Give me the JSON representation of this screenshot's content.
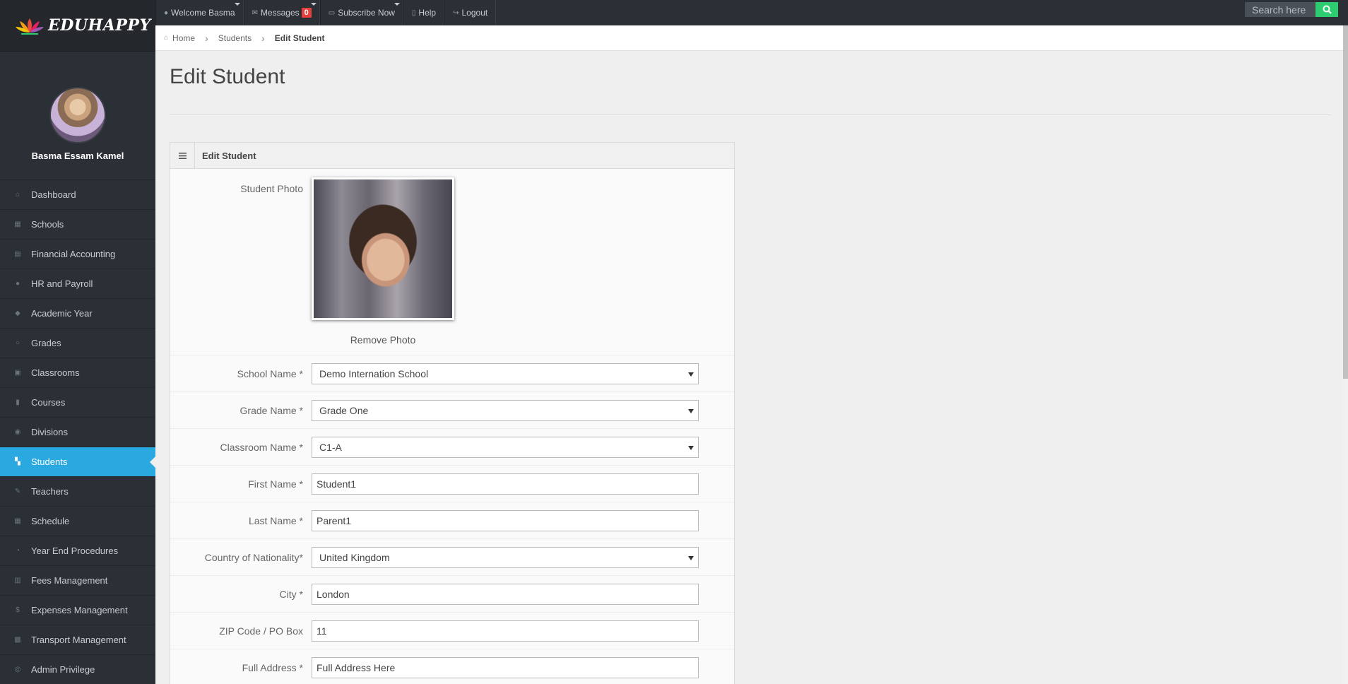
{
  "app": {
    "logo_text": "EDUHAPPY"
  },
  "profile": {
    "name": "Basma Essam Kamel"
  },
  "sidebar": {
    "items": [
      {
        "label": "Dashboard",
        "icon": "home-icon",
        "glyph": "⌂",
        "active": false
      },
      {
        "label": "Schools",
        "icon": "building-icon",
        "glyph": "▦",
        "active": false
      },
      {
        "label": "Financial Accounting",
        "icon": "accounting-icon",
        "glyph": "▤",
        "active": false
      },
      {
        "label": "HR and Payroll",
        "icon": "user-icon",
        "glyph": "●",
        "active": false
      },
      {
        "label": "Academic Year",
        "icon": "graduation-cap-icon",
        "glyph": "◆",
        "active": false
      },
      {
        "label": "Grades",
        "icon": "lightbulb-icon",
        "glyph": "○",
        "active": false
      },
      {
        "label": "Classrooms",
        "icon": "classroom-icon",
        "glyph": "▣",
        "active": false
      },
      {
        "label": "Courses",
        "icon": "book-icon",
        "glyph": "▮",
        "active": false
      },
      {
        "label": "Divisions",
        "icon": "globe-icon",
        "glyph": "◉",
        "active": false
      },
      {
        "label": "Students",
        "icon": "students-icon",
        "glyph": "▚",
        "active": true
      },
      {
        "label": "Teachers",
        "icon": "teacher-icon",
        "glyph": "✎",
        "active": false
      },
      {
        "label": "Schedule",
        "icon": "calendar-icon",
        "glyph": "▦",
        "active": false
      },
      {
        "label": "Year End Procedures",
        "icon": "clock-icon",
        "glyph": "◔",
        "active": false
      },
      {
        "label": "Fees Management",
        "icon": "fees-icon",
        "glyph": "▥",
        "active": false
      },
      {
        "label": "Expenses Management",
        "icon": "dollar-icon",
        "glyph": "$",
        "active": false
      },
      {
        "label": "Transport Management",
        "icon": "bus-icon",
        "glyph": "▩",
        "active": false
      },
      {
        "label": "Admin Privilege",
        "icon": "shield-icon",
        "glyph": "◎",
        "active": false
      }
    ]
  },
  "topbar": {
    "welcome": "Welcome Basma",
    "messages": "Messages",
    "messages_count": "0",
    "subscribe": "Subscribe Now",
    "help": "Help",
    "logout": "Logout",
    "search_placeholder": "Search here"
  },
  "breadcrumb": {
    "home": "Home",
    "section": "Students",
    "current": "Edit Student"
  },
  "page": {
    "title": "Edit Student"
  },
  "panel": {
    "title": "Edit Student",
    "photo_label": "Student Photo",
    "remove_photo": "Remove Photo",
    "fields": {
      "school": {
        "label": "School Name *",
        "value": "Demo Internation School"
      },
      "grade": {
        "label": "Grade Name *",
        "value": "Grade One"
      },
      "classroom": {
        "label": "Classroom Name *",
        "value": "C1-A"
      },
      "first_name": {
        "label": "First Name *",
        "value": "Student1"
      },
      "last_name": {
        "label": "Last Name *",
        "value": "Parent1"
      },
      "country": {
        "label": "Country of Nationality*",
        "value": "United Kingdom"
      },
      "city": {
        "label": "City *",
        "value": "London"
      },
      "zip": {
        "label": "ZIP Code / PO Box",
        "value": "11"
      },
      "address": {
        "label": "Full Address *",
        "value": "Full Address Here"
      }
    }
  },
  "colors": {
    "sidebar_bg": "#2b3036",
    "accent_active": "#29a9e0",
    "search_button": "#2ecc71",
    "badge": "#e83f3f"
  }
}
